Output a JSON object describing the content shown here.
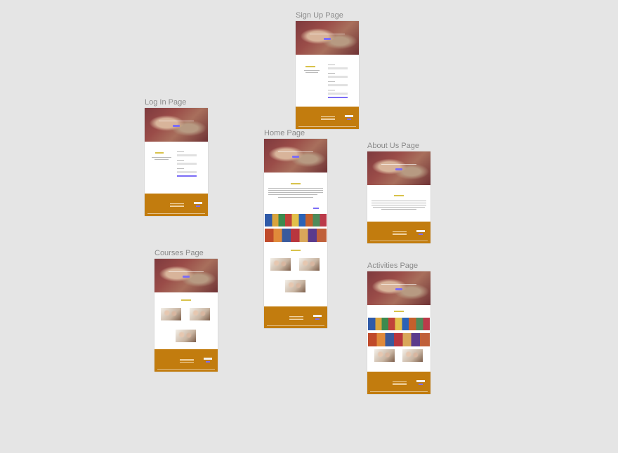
{
  "canvas": {
    "background": "#e5e5e5"
  },
  "frames": {
    "signup": {
      "label": "Sign Up Page"
    },
    "login": {
      "label": "Log In Page"
    },
    "home": {
      "label": "Home Page"
    },
    "about": {
      "label": "About Us Page"
    },
    "courses": {
      "label": "Courses Page"
    },
    "activities": {
      "label": "Activities Page"
    }
  },
  "colors": {
    "footer": "#c27c0e",
    "accent_button": "#7b6cf6",
    "heading": "#d8c24a"
  }
}
